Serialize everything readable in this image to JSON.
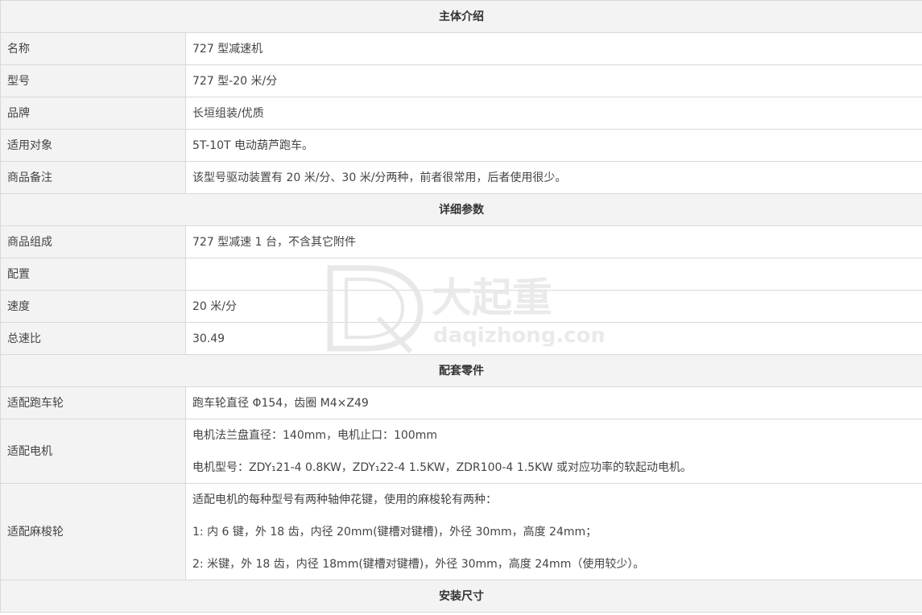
{
  "sections": {
    "intro": "主体介绍",
    "details": "详细参数",
    "parts": "配套零件",
    "install": "安装尺寸"
  },
  "rows": {
    "name": {
      "label": "名称",
      "value": "727 型减速机"
    },
    "model": {
      "label": "型号",
      "value": "727 型-20 米/分"
    },
    "brand": {
      "label": "品牌",
      "value": "长垣组装/优质"
    },
    "target": {
      "label": "适用对象",
      "value": "5T-10T 电动葫芦跑车。"
    },
    "note": {
      "label": "商品备注",
      "value": "该型号驱动装置有 20 米/分、30 米/分两种，前者很常用，后者使用很少。"
    },
    "composition": {
      "label": "商品组成",
      "value": "727 型减速 1 台，不含其它附件"
    },
    "config": {
      "label": "配置",
      "value": ""
    },
    "speed": {
      "label": "速度",
      "value": "20  米/分"
    },
    "ratio": {
      "label": "总速比",
      "value": "30.49"
    },
    "wheel": {
      "label": "适配跑车轮",
      "value": "跑车轮直径 Φ154，齿圈 M4×Z49"
    },
    "motor": {
      "label": "适配电机",
      "line1": "电机法兰盘直径：140mm，电机止口：100mm",
      "line2": "电机型号：ZDY₁21-4    0.8KW，ZDY₁22-4    1.5KW，ZDR100-4    1.5KW 或对应功率的软起动电机。"
    },
    "spline": {
      "label": "适配麻梭轮",
      "line1": "适配电机的每种型号有两种轴伸花键，使用的麻梭轮有两种：",
      "line2": "1:  内 6 键，外 18 齿，内径 20mm(键槽对键槽)，外径 30mm，高度 24mm；",
      "line3": "2:  米键，外 18 齿，内径 18mm(键槽对键槽)，外径 30mm，高度 24mm（使用较少）。"
    }
  },
  "watermark": {
    "cn": "大起重",
    "en": "daqizhong.com",
    "color": "#e8e8e8"
  }
}
